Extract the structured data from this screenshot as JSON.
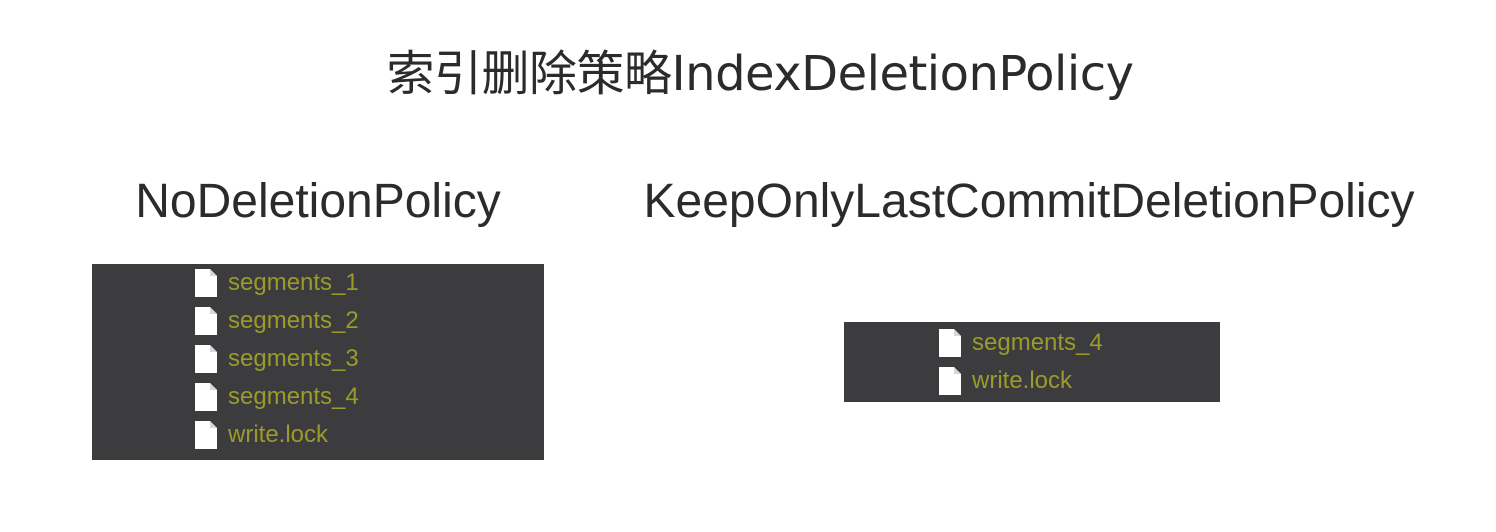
{
  "title": "索引删除策略IndexDeletionPolicy",
  "policies": [
    {
      "name": "NoDeletionPolicy",
      "files": [
        "segments_1",
        "segments_2",
        "segments_3",
        "segments_4",
        "write.lock"
      ]
    },
    {
      "name": "KeepOnlyLastCommitDeletionPolicy",
      "files": [
        "segments_4",
        "write.lock"
      ]
    }
  ],
  "colors": {
    "panel_background": "#3c3c3e",
    "file_name_text": "#9a9b2a",
    "file_icon": "#ffffff",
    "heading_text": "#2b2b2b"
  },
  "icons": {
    "file": "file-icon"
  }
}
